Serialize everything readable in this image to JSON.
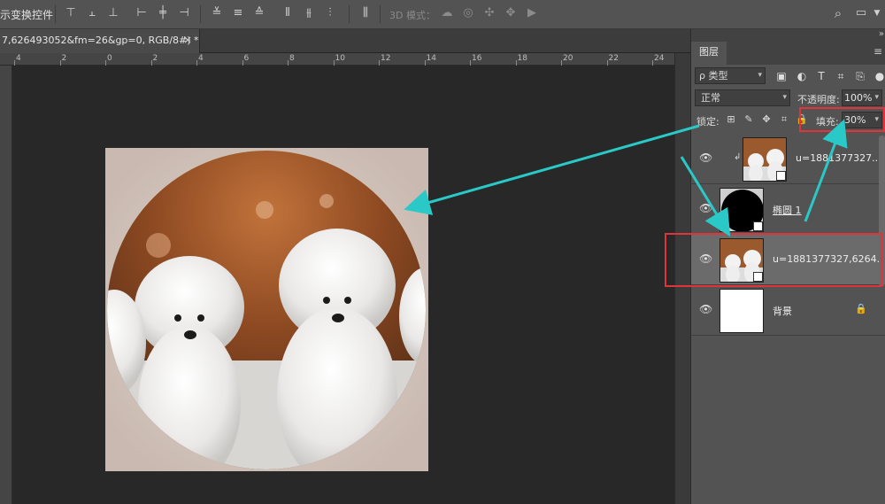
{
  "options_bar": {
    "transform_controls_label": "示变换控件",
    "mode_3d_label": "3D 模式："
  },
  "document_tab": {
    "title": "7,626493052&fm=26&gp=0, RGB/8#) *",
    "close": "×"
  },
  "ruler": {
    "top_labels": [
      "4",
      "2",
      "0",
      "2",
      "4",
      "6",
      "8",
      "10",
      "12",
      "14",
      "16",
      "18",
      "20",
      "22",
      "24"
    ]
  },
  "layers_panel": {
    "tab_label": "图层",
    "collapse_glyph": "»",
    "menu_glyph": "≡",
    "filter_kind": "ρ 类型",
    "blend_mode": "正常",
    "opacity_label": "不透明度:",
    "opacity_value": "100%",
    "lock_label": "锁定:",
    "fill_label": "填充:",
    "fill_value": "30%",
    "layers": [
      {
        "name": "u=1881377327...",
        "kind": "clipped-photo"
      },
      {
        "name": "椭圆 1",
        "kind": "shape"
      },
      {
        "name": "u=1881377327,6264...",
        "kind": "photo",
        "selected": true
      },
      {
        "name": "背景",
        "kind": "background",
        "locked": true
      }
    ]
  },
  "colors": {
    "annotation_red": "#e0343a",
    "annotation_arrow": "#2bc8c8",
    "panel_bg": "#535353",
    "canvas_bg": "#282828"
  }
}
